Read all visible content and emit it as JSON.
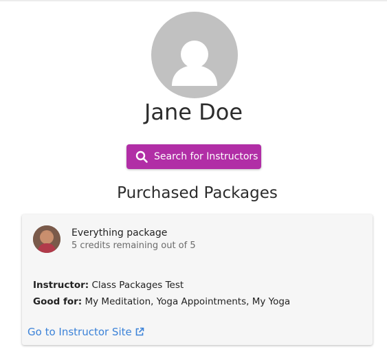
{
  "profile": {
    "name": "Jane Doe",
    "avatar_icon": "person-icon"
  },
  "actions": {
    "search_label": "Search for Instructors",
    "search_icon": "search-icon",
    "accent_color": "#b12ea6"
  },
  "packages": {
    "section_title": "Purchased Packages",
    "items": [
      {
        "name": "Everything package",
        "credits": "5 credits remaining out of 5",
        "instructor_label": "Instructor:",
        "instructor_value": "Class Packages Test",
        "good_for_label": "Good for:",
        "good_for_value": "My Meditation, Yoga Appointments, My Yoga",
        "link_label": "Go to Instructor Site",
        "link_icon": "external-link-icon",
        "link_color": "#3b82d8"
      }
    ]
  }
}
